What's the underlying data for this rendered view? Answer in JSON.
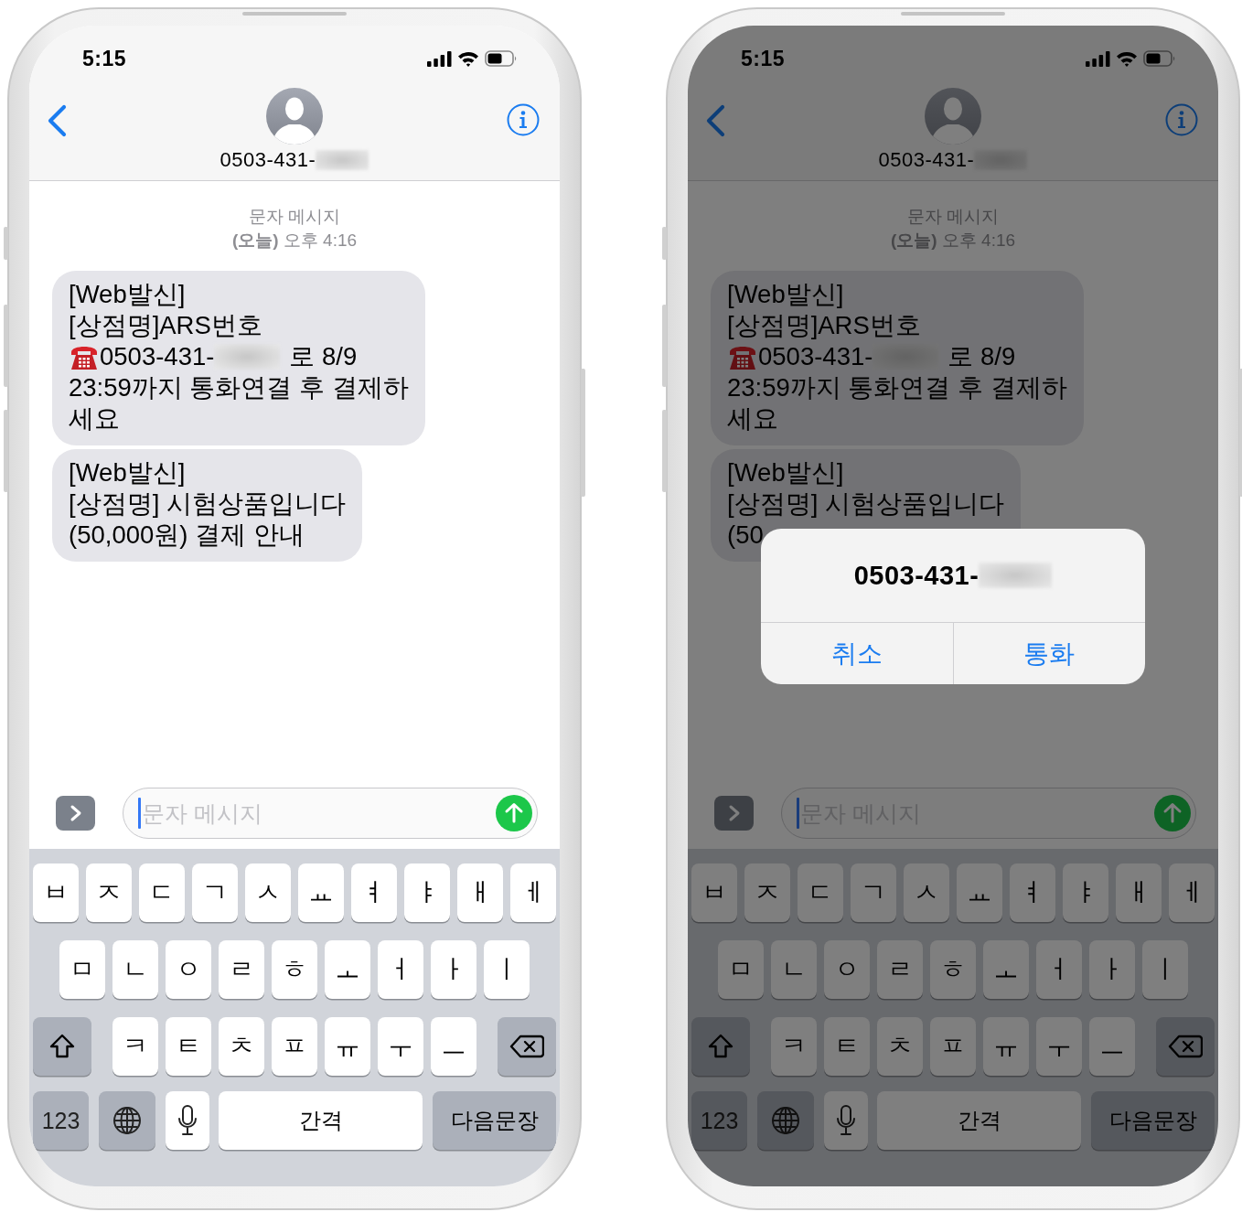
{
  "phones": [
    {
      "dimmed": false,
      "status_bar": {
        "time": "5:15"
      },
      "header": {
        "contact": "0503-431-",
        "redacted": true
      },
      "conversation": {
        "label": "문자 메시지",
        "timestamp": "**(오늘)** 오후 4:16",
        "messages": [
          {
            "lines": [
              {
                "kind": "text",
                "text": "[Web발신]"
              },
              {
                "kind": "text",
                "text": "[상점명]ARS번호"
              },
              {
                "kind": "phone",
                "text": "0503-431-",
                "redacted": true,
                "after": "로 8/9"
              },
              {
                "kind": "text",
                "text": "23:59까지 통화연결 후 결제하"
              },
              {
                "kind": "text",
                "text": "세요"
              }
            ]
          },
          {
            "lines": [
              {
                "kind": "text",
                "text": "[Web발신]"
              },
              {
                "kind": "text",
                "text": "[상점명] 시험상품입니다"
              },
              {
                "kind": "text",
                "text": "(50,000원) 결제 안내"
              }
            ]
          }
        ]
      },
      "composer": {
        "placeholder": "문자 메시지"
      },
      "keyboard": {
        "rows": [
          {
            "keys": [
              {
                "kind": "letter",
                "label": "ㅂ"
              },
              {
                "kind": "letter",
                "label": "ㅈ"
              },
              {
                "kind": "letter",
                "label": "ㄷ"
              },
              {
                "kind": "letter",
                "label": "ㄱ"
              },
              {
                "kind": "letter",
                "label": "ㅅ"
              },
              {
                "kind": "letter",
                "label": "ㅛ"
              },
              {
                "kind": "letter",
                "label": "ㅕ"
              },
              {
                "kind": "letter",
                "label": "ㅑ"
              },
              {
                "kind": "letter",
                "label": "ㅐ"
              },
              {
                "kind": "letter",
                "label": "ㅔ"
              }
            ]
          },
          {
            "keys": [
              {
                "kind": "letter",
                "label": "ㅁ"
              },
              {
                "kind": "letter",
                "label": "ㄴ"
              },
              {
                "kind": "letter",
                "label": "ㅇ"
              },
              {
                "kind": "letter",
                "label": "ㄹ"
              },
              {
                "kind": "letter",
                "label": "ㅎ"
              },
              {
                "kind": "letter",
                "label": "ㅗ"
              },
              {
                "kind": "letter",
                "label": "ㅓ"
              },
              {
                "kind": "letter",
                "label": "ㅏ"
              },
              {
                "kind": "letter",
                "label": "ㅣ"
              }
            ]
          },
          {
            "keys": [
              {
                "kind": "shift"
              },
              {
                "kind": "letter",
                "label": "ㅋ"
              },
              {
                "kind": "letter",
                "label": "ㅌ"
              },
              {
                "kind": "letter",
                "label": "ㅊ"
              },
              {
                "kind": "letter",
                "label": "ㅍ"
              },
              {
                "kind": "letter",
                "label": "ㅠ"
              },
              {
                "kind": "letter",
                "label": "ㅜ"
              },
              {
                "kind": "letter",
                "label": "ㅡ"
              },
              {
                "kind": "backspace"
              }
            ]
          },
          {
            "keys": [
              {
                "kind": "numbers",
                "label": "123"
              },
              {
                "kind": "globe"
              },
              {
                "kind": "mic"
              },
              {
                "kind": "space",
                "label": "간격"
              },
              {
                "kind": "return",
                "label": "다음문장"
              }
            ]
          }
        ]
      }
    },
    {
      "dimmed": true,
      "status_bar": {
        "time": "5:15"
      },
      "header": {
        "contact": "0503-431-",
        "redacted": true
      },
      "conversation": {
        "label": "문자 메시지",
        "timestamp": "**(오늘)** 오후 4:16",
        "messages": [
          {
            "lines": [
              {
                "kind": "text",
                "text": "[Web발신]"
              },
              {
                "kind": "text",
                "text": "[상점명]ARS번호"
              },
              {
                "kind": "phone",
                "text": "0503-431-",
                "redacted": true,
                "after": "로 8/9"
              },
              {
                "kind": "text",
                "text": "23:59까지 통화연결 후 결제하"
              },
              {
                "kind": "text",
                "text": "세요"
              }
            ]
          },
          {
            "lines": [
              {
                "kind": "text",
                "text": "[Web발신]"
              },
              {
                "kind": "text",
                "text": "[상점명] 시험상품입니다"
              },
              {
                "kind": "text",
                "text": "(50"
              }
            ]
          }
        ]
      },
      "composer": {
        "placeholder": "문자 메시지"
      },
      "keyboard": {
        "rows": [
          {
            "keys": [
              {
                "kind": "letter",
                "label": "ㅂ"
              },
              {
                "kind": "letter",
                "label": "ㅈ"
              },
              {
                "kind": "letter",
                "label": "ㄷ"
              },
              {
                "kind": "letter",
                "label": "ㄱ"
              },
              {
                "kind": "letter",
                "label": "ㅅ"
              },
              {
                "kind": "letter",
                "label": "ㅛ"
              },
              {
                "kind": "letter",
                "label": "ㅕ"
              },
              {
                "kind": "letter",
                "label": "ㅑ"
              },
              {
                "kind": "letter",
                "label": "ㅐ"
              },
              {
                "kind": "letter",
                "label": "ㅔ"
              }
            ]
          },
          {
            "keys": [
              {
                "kind": "letter",
                "label": "ㅁ"
              },
              {
                "kind": "letter",
                "label": "ㄴ"
              },
              {
                "kind": "letter",
                "label": "ㅇ"
              },
              {
                "kind": "letter",
                "label": "ㄹ"
              },
              {
                "kind": "letter",
                "label": "ㅎ"
              },
              {
                "kind": "letter",
                "label": "ㅗ"
              },
              {
                "kind": "letter",
                "label": "ㅓ"
              },
              {
                "kind": "letter",
                "label": "ㅏ"
              },
              {
                "kind": "letter",
                "label": "ㅣ"
              }
            ]
          },
          {
            "keys": [
              {
                "kind": "shift"
              },
              {
                "kind": "letter",
                "label": "ㅋ"
              },
              {
                "kind": "letter",
                "label": "ㅌ"
              },
              {
                "kind": "letter",
                "label": "ㅊ"
              },
              {
                "kind": "letter",
                "label": "ㅍ"
              },
              {
                "kind": "letter",
                "label": "ㅠ"
              },
              {
                "kind": "letter",
                "label": "ㅜ"
              },
              {
                "kind": "letter",
                "label": "ㅡ"
              },
              {
                "kind": "backspace"
              }
            ]
          },
          {
            "keys": [
              {
                "kind": "numbers",
                "label": "123"
              },
              {
                "kind": "globe"
              },
              {
                "kind": "mic"
              },
              {
                "kind": "space",
                "label": "간격"
              },
              {
                "kind": "return",
                "label": "다음문장"
              }
            ]
          }
        ]
      },
      "alert": {
        "title": "0503-431-",
        "redacted": true,
        "buttons": [
          "취소",
          "통화"
        ]
      }
    }
  ]
}
